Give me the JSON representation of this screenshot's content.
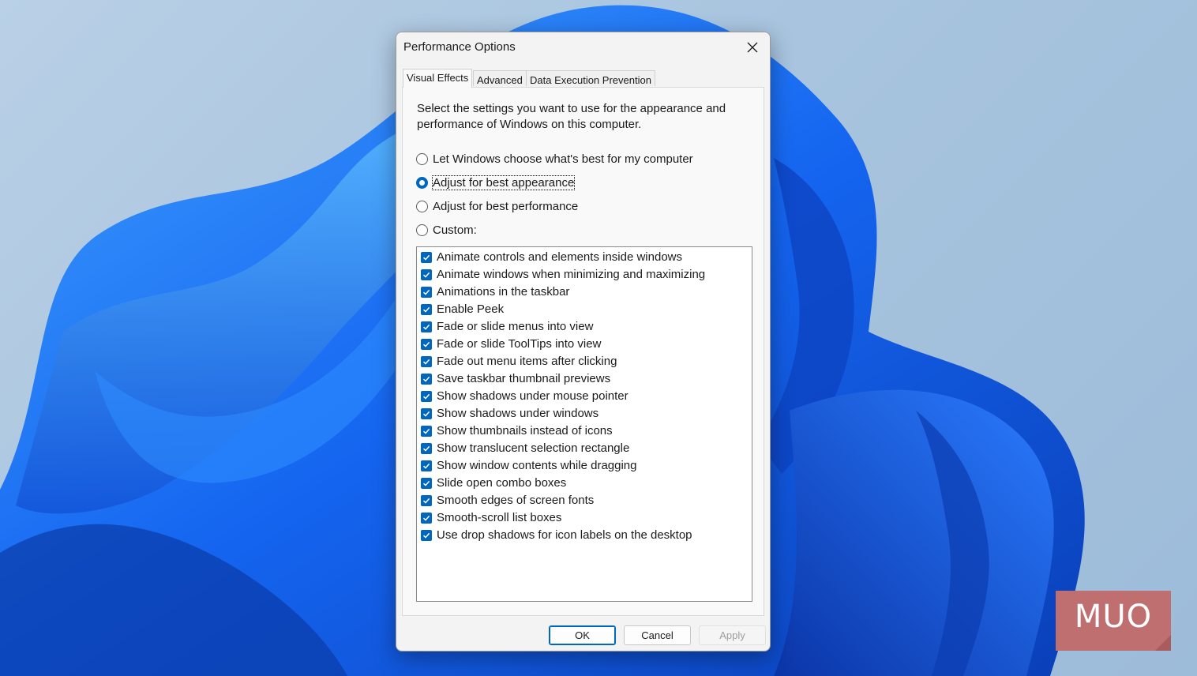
{
  "colors": {
    "accent": "#0067c0",
    "wallpaper_blue": "#1a5fe8",
    "wallpaper_bg": "#a9c5df",
    "logo_bg": "#bf6f6f"
  },
  "dialog": {
    "title": "Performance Options",
    "close_icon": "close-icon",
    "tabs": [
      {
        "label": "Visual Effects",
        "active": true
      },
      {
        "label": "Advanced",
        "active": false
      },
      {
        "label": "Data Execution Prevention",
        "active": false
      }
    ],
    "description": "Select the settings you want to use for the appearance and performance of Windows on this computer.",
    "radio_options": [
      {
        "label": "Let Windows choose what's best for my computer",
        "checked": false
      },
      {
        "label": "Adjust for best appearance",
        "checked": true
      },
      {
        "label": "Adjust for best performance",
        "checked": false
      },
      {
        "label": "Custom:",
        "checked": false
      }
    ],
    "effects": [
      {
        "label": "Animate controls and elements inside windows",
        "checked": true
      },
      {
        "label": "Animate windows when minimizing and maximizing",
        "checked": true
      },
      {
        "label": "Animations in the taskbar",
        "checked": true
      },
      {
        "label": "Enable Peek",
        "checked": true
      },
      {
        "label": "Fade or slide menus into view",
        "checked": true
      },
      {
        "label": "Fade or slide ToolTips into view",
        "checked": true
      },
      {
        "label": "Fade out menu items after clicking",
        "checked": true
      },
      {
        "label": "Save taskbar thumbnail previews",
        "checked": true
      },
      {
        "label": "Show shadows under mouse pointer",
        "checked": true
      },
      {
        "label": "Show shadows under windows",
        "checked": true
      },
      {
        "label": "Show thumbnails instead of icons",
        "checked": true
      },
      {
        "label": "Show translucent selection rectangle",
        "checked": true
      },
      {
        "label": "Show window contents while dragging",
        "checked": true
      },
      {
        "label": "Slide open combo boxes",
        "checked": true
      },
      {
        "label": "Smooth edges of screen fonts",
        "checked": true
      },
      {
        "label": "Smooth-scroll list boxes",
        "checked": true
      },
      {
        "label": "Use drop shadows for icon labels on the desktop",
        "checked": true
      }
    ],
    "buttons": {
      "ok": "OK",
      "cancel": "Cancel",
      "apply": "Apply"
    }
  },
  "watermark": {
    "text": "MUO"
  }
}
